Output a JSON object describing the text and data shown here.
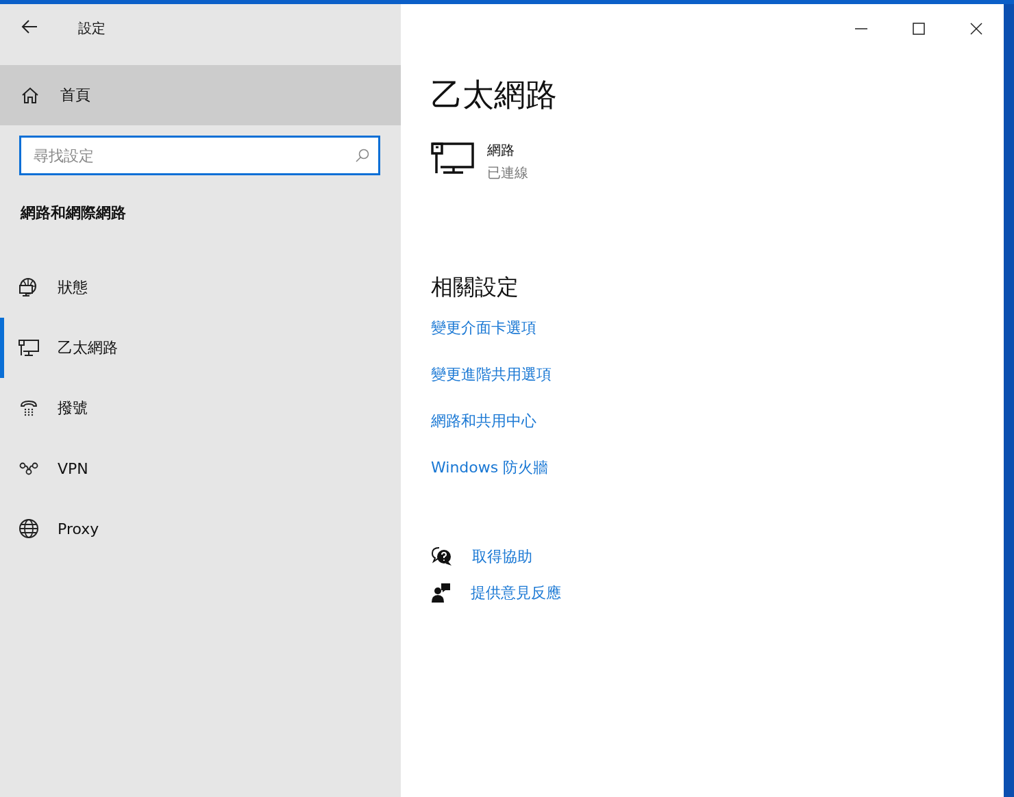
{
  "window": {
    "title": "設定"
  },
  "sidebar": {
    "home": {
      "label": "首頁",
      "hovered": true
    },
    "search": {
      "placeholder": "尋找設定"
    },
    "section_title": "網路和網際網路",
    "items": [
      {
        "label": "狀態",
        "kind": "status",
        "selected": false
      },
      {
        "label": "乙太網路",
        "kind": "ethernet",
        "selected": true
      },
      {
        "label": "撥號",
        "kind": "dialup",
        "selected": false
      },
      {
        "label": "VPN",
        "kind": "vpn",
        "selected": false
      },
      {
        "label": "Proxy",
        "kind": "proxy",
        "selected": false
      }
    ]
  },
  "page": {
    "title": "乙太網路",
    "network": {
      "name": "網路",
      "status": "已連線"
    },
    "related_title": "相關設定",
    "related_links": [
      "變更介面卡選項",
      "變更進階共用選項",
      "網路和共用中心",
      "Windows 防火牆"
    ],
    "help_links": [
      {
        "label": "取得協助",
        "kind": "help"
      },
      {
        "label": "提供意見反應",
        "kind": "feedback"
      }
    ]
  }
}
